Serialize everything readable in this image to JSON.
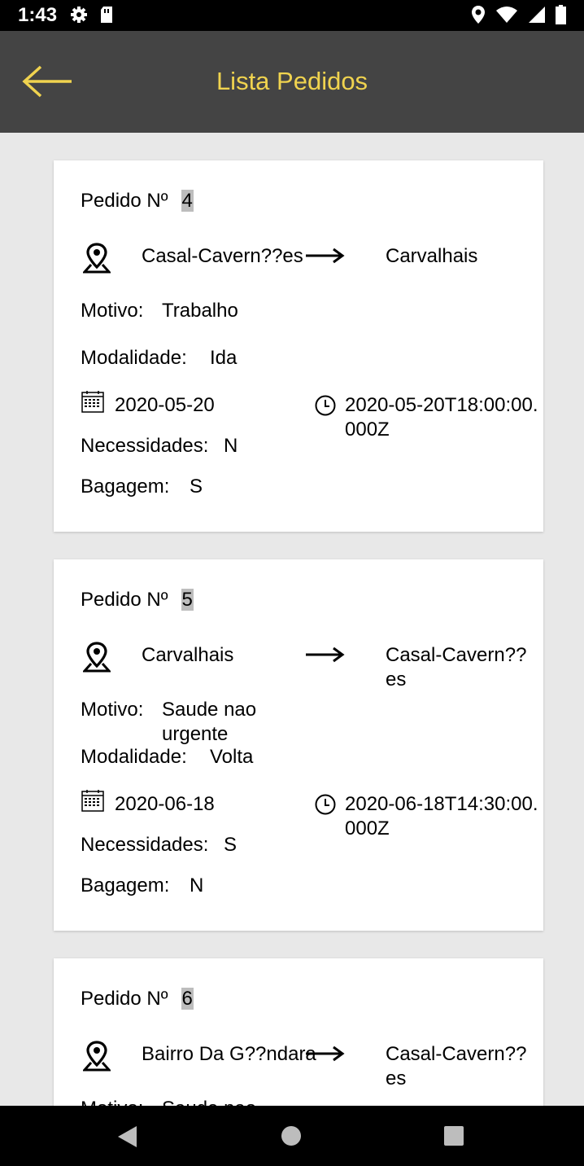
{
  "status_bar": {
    "time": "1:43"
  },
  "header": {
    "title": "Lista Pedidos",
    "accent_color": "#f0d34f"
  },
  "labels": {
    "pedido": "Pedido Nº",
    "motivo": "Motivo:",
    "modalidade": "Modalidade:",
    "necessidades": "Necessidades:",
    "bagagem": "Bagagem:"
  },
  "pedidos": [
    {
      "numero": "4",
      "origem": "Casal-Cavern??es",
      "destino": "Carvalhais",
      "motivo": "Trabalho",
      "modalidade": "Ida",
      "data": "2020-05-20",
      "hora": "2020-05-20T18:00:00.000Z",
      "necessidades": "N",
      "bagagem": "S"
    },
    {
      "numero": "5",
      "origem": "Carvalhais",
      "destino": "Casal-Cavern??es",
      "motivo": "Saude nao urgente",
      "modalidade": "Volta",
      "data": "2020-06-18",
      "hora": "2020-06-18T14:30:00.000Z",
      "necessidades": "S",
      "bagagem": "N"
    },
    {
      "numero": "6",
      "origem": "Bairro Da G??ndara",
      "destino": "Casal-Cavern??es",
      "motivo": "Saude nao"
    }
  ]
}
